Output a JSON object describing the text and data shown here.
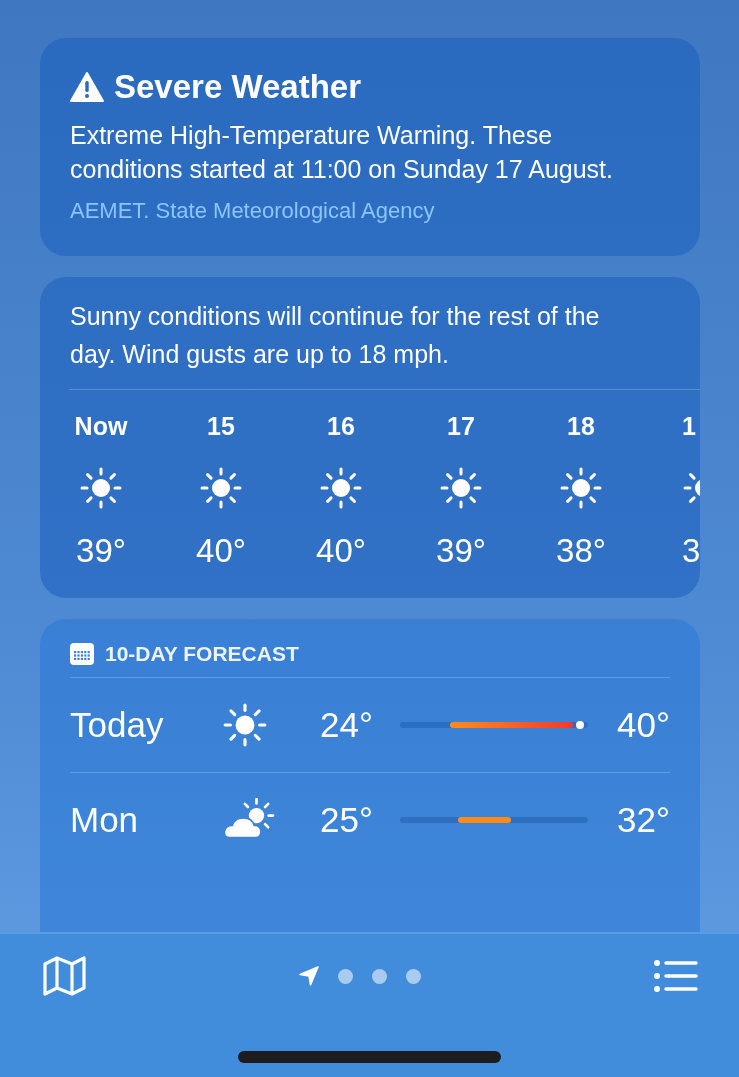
{
  "alert": {
    "title": "Severe Weather",
    "message": "Extreme High-Temperature Warning. These conditions started at 11:00 on Sunday 17 August.",
    "source": "AEMET. State Meteorological Agency"
  },
  "hourly": {
    "summary": "Sunny conditions will continue for the rest of the day. Wind gusts are up to 18 mph.",
    "hours": [
      {
        "time": "Now",
        "temp": "39°"
      },
      {
        "time": "15",
        "temp": "40°"
      },
      {
        "time": "16",
        "temp": "40°"
      },
      {
        "time": "17",
        "temp": "39°"
      },
      {
        "time": "18",
        "temp": "38°"
      },
      {
        "time": "1",
        "temp": "3"
      }
    ]
  },
  "forecast": {
    "title": "10-DAY FORECAST",
    "days": [
      {
        "day": "Today",
        "kind": "sun",
        "low": "24°",
        "high": "40°",
        "current": {
          "level": 0.96
        }
      },
      {
        "day": "Mon",
        "kind": "partly-cloudy",
        "low": "25°",
        "high": "32°"
      }
    ]
  },
  "page_dots": [
    {
      "kind": "location",
      "selected": true
    },
    {
      "kind": "dot",
      "selected": false
    },
    {
      "kind": "dot",
      "selected": false
    },
    {
      "kind": "dot",
      "selected": false
    }
  ]
}
